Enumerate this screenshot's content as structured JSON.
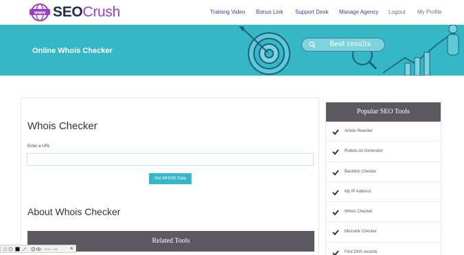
{
  "logo": {
    "text_bold": "SEO",
    "text_light": "Crush",
    "globe_text": "www"
  },
  "nav": [
    {
      "label": "Training Video",
      "style": "primary"
    },
    {
      "label": "Bonus Link",
      "style": "primary"
    },
    {
      "label": "Support Desk",
      "style": "primary"
    },
    {
      "label": "Manage Agency",
      "style": "primary"
    },
    {
      "label": "Logout",
      "style": "muted"
    },
    {
      "label": "My Profile",
      "style": "muted"
    }
  ],
  "banner": {
    "title": "Online Whois Checker",
    "search_text": "Best results"
  },
  "main": {
    "title": "Whois Checker",
    "url_label": "Enter a URL",
    "url_value": "",
    "url_placeholder": "",
    "button_label": "Get WHOIS Data",
    "about_title": "About Whois Checker",
    "related_title": "Related Tools"
  },
  "sidebar": {
    "title": "Popular SEO Tools",
    "items": [
      {
        "label": "Article Rewriter"
      },
      {
        "label": "Robots.txt Generator"
      },
      {
        "label": "Backlink Checker"
      },
      {
        "label": "My IP Address"
      },
      {
        "label": "Whois Checker"
      },
      {
        "label": "Mozrank Checker"
      },
      {
        "label": "Find DNS records"
      }
    ]
  },
  "devbar": {
    "size_text": "1273 × 700",
    "close": "×"
  },
  "colors": {
    "accent": "#36b7c6",
    "brand_dark": "#252a53",
    "brand_purple": "#9b3fbf",
    "nav_link": "#3b3f8f",
    "panel_header": "#5b595f"
  }
}
